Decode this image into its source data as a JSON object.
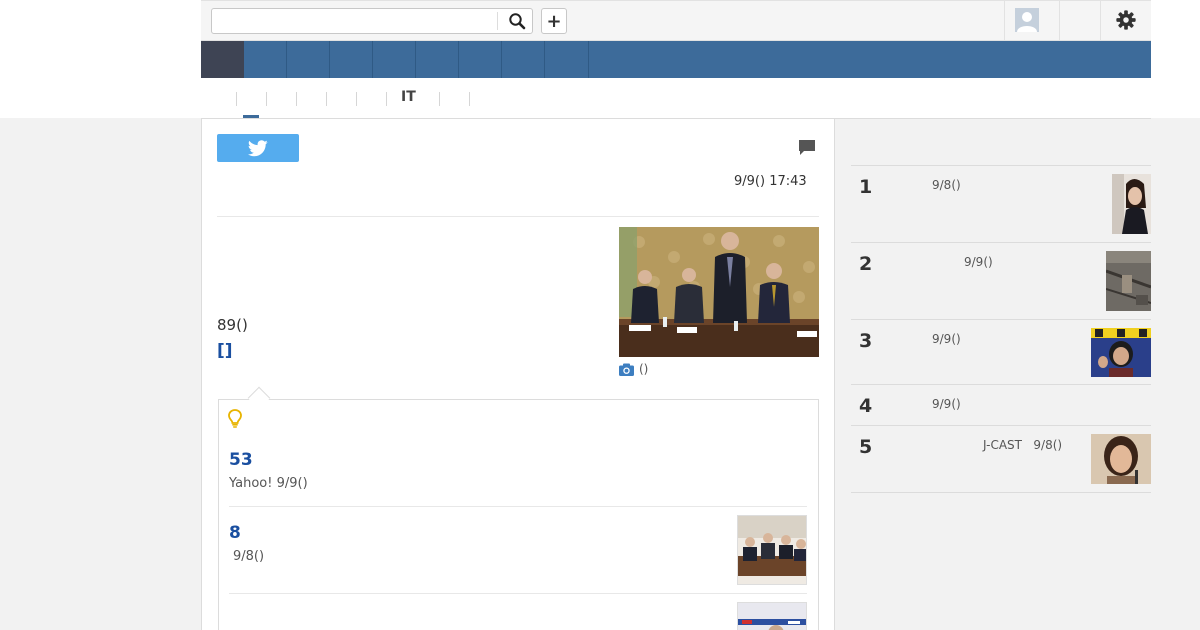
{
  "header": {
    "search_placeholder": "",
    "add_label": "+"
  },
  "subnav": {
    "it_label": "IT"
  },
  "article": {
    "date": "9/9() 17:43",
    "count_text": "89()",
    "bracket_link": "[]",
    "photo_caption": "()"
  },
  "related": {
    "items": [
      {
        "num": "53",
        "meta": "Yahoo! 9/9()"
      },
      {
        "num": "8",
        "meta": "9/8()"
      }
    ]
  },
  "ranking": {
    "items": [
      {
        "rank": "1",
        "meta": "9/8()"
      },
      {
        "rank": "2",
        "meta": "9/9()"
      },
      {
        "rank": "3",
        "meta": "9/9()"
      },
      {
        "rank": "4",
        "meta": "9/9()"
      },
      {
        "rank": "5",
        "meta": "J-CAST   9/8()"
      }
    ]
  },
  "colors": {
    "nav_blue": "#3d6b9a",
    "nav_home": "#3e4454",
    "link_blue": "#1a4fa0",
    "twitter_blue": "#55acee",
    "bulb_yellow": "#e8b400"
  },
  "icons": [
    "search-icon",
    "plus-icon",
    "user-avatar-icon",
    "gear-icon",
    "twitter-icon",
    "comment-icon",
    "camera-icon",
    "lightbulb-icon"
  ]
}
